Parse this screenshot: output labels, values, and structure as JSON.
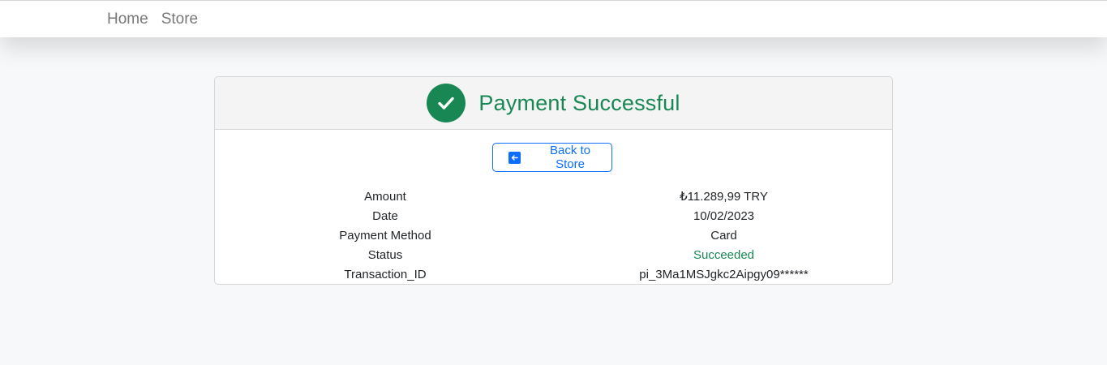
{
  "navbar": {
    "links": [
      {
        "label": "Home"
      },
      {
        "label": "Store"
      }
    ]
  },
  "card": {
    "title": "Payment Successful",
    "header_icon": "check-circle-icon",
    "back_button_label": "Back to Store",
    "back_icon": "arrow-left-square-icon",
    "details": [
      {
        "label": "Amount",
        "value": "₺11.289,99 TRY"
      },
      {
        "label": "Date",
        "value": "10/02/2023"
      },
      {
        "label": "Payment Method",
        "value": "Card"
      },
      {
        "label": "Status",
        "value": "Succeeded"
      },
      {
        "label": "Transaction_ID",
        "value": "pi_3Ma1MSJgkc2Aipgy09******"
      }
    ]
  },
  "colors": {
    "success": "#198754",
    "primary": "#0d6efd",
    "page_background": "#f7f8f9"
  }
}
